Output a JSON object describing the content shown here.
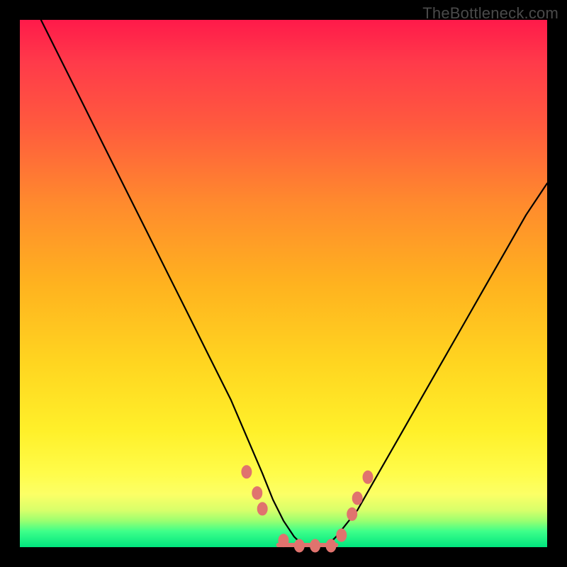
{
  "watermark": "TheBottleneck.com",
  "colors": {
    "frame": "#000000",
    "curve": "#000000",
    "marker": "#e0736e",
    "gradient_top": "#ff1a4a",
    "gradient_mid": "#ffd520",
    "gradient_bottom": "#00e57e"
  },
  "chart_data": {
    "type": "line",
    "title": "",
    "xlabel": "",
    "ylabel": "",
    "xlim": [
      0,
      100
    ],
    "ylim": [
      0,
      100
    ],
    "series": [
      {
        "name": "bottleneck-curve",
        "x": [
          4,
          8,
          12,
          16,
          20,
          24,
          28,
          32,
          36,
          40,
          43,
          46,
          48,
          50,
          52,
          54,
          56,
          58,
          60,
          64,
          68,
          72,
          76,
          80,
          84,
          88,
          92,
          96,
          100
        ],
        "values": [
          100,
          92,
          84,
          76,
          68,
          60,
          52,
          44,
          36,
          28,
          21,
          14,
          9,
          5,
          2,
          0,
          0,
          0,
          2,
          7,
          14,
          21,
          28,
          35,
          42,
          49,
          56,
          63,
          69
        ]
      }
    ],
    "markers": [
      {
        "x": 43,
        "y": 14
      },
      {
        "x": 45,
        "y": 10
      },
      {
        "x": 46,
        "y": 7
      },
      {
        "x": 50,
        "y": 1
      },
      {
        "x": 53,
        "y": 0
      },
      {
        "x": 56,
        "y": 0
      },
      {
        "x": 59,
        "y": 0
      },
      {
        "x": 61,
        "y": 2
      },
      {
        "x": 63,
        "y": 6
      },
      {
        "x": 64,
        "y": 9
      },
      {
        "x": 66,
        "y": 13
      }
    ],
    "floor_segment": {
      "x0": 49,
      "x1": 60,
      "y": 0
    }
  }
}
